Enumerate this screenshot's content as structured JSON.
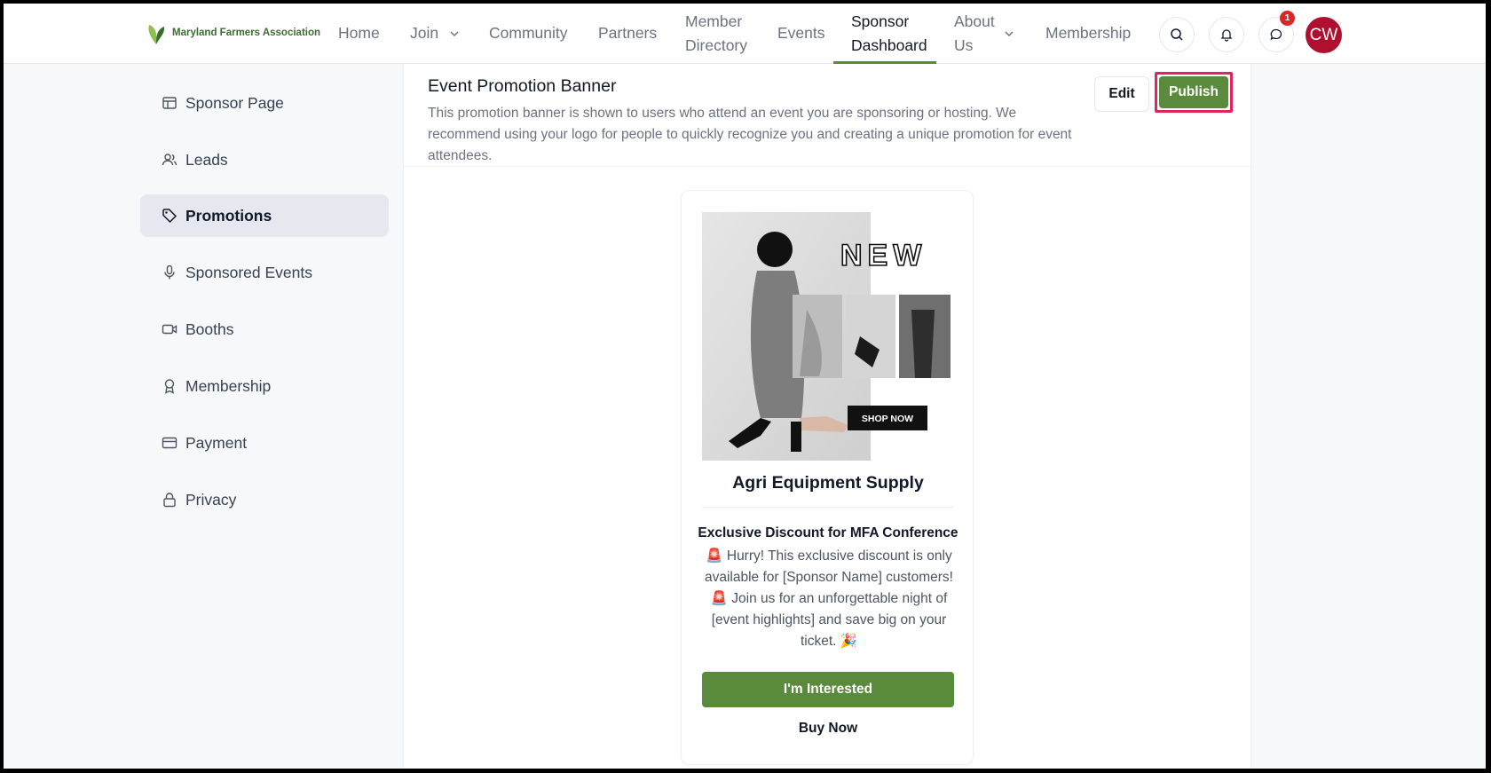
{
  "brand": {
    "name": "Maryland Farmers Association",
    "logo_icon": "leaf-icon"
  },
  "nav": {
    "home": "Home",
    "join": "Join",
    "community": "Community",
    "partners": "Partners",
    "member_directory_1": "Member",
    "member_directory_2": "Directory",
    "events": "Events",
    "sponsor_dashboard_1": "Sponsor",
    "sponsor_dashboard_2": "Dashboard",
    "about_1": "About",
    "about_2": "Us",
    "membership": "Membership"
  },
  "header_actions": {
    "notification_count": "1",
    "avatar_initials": "CW"
  },
  "sidebar": {
    "items": [
      {
        "label": "Sponsor Page",
        "icon": "layout-icon"
      },
      {
        "label": "Leads",
        "icon": "users-icon"
      },
      {
        "label": "Promotions",
        "icon": "tag-icon"
      },
      {
        "label": "Sponsored Events",
        "icon": "microphone-icon"
      },
      {
        "label": "Booths",
        "icon": "video-camera-icon"
      },
      {
        "label": "Membership",
        "icon": "award-icon"
      },
      {
        "label": "Payment",
        "icon": "credit-card-icon"
      },
      {
        "label": "Privacy",
        "icon": "lock-icon"
      }
    ],
    "active_index": 2
  },
  "panel": {
    "title": "Event Promotion Banner",
    "description": "This promotion banner is shown to users who attend an event you are sponsoring or hosting. We recommend using your logo for people to quickly recognize you and creating a unique promotion for event attendees.",
    "edit_label": "Edit",
    "publish_label": "Publish"
  },
  "promo_card": {
    "image_text_new": "NEW",
    "image_text_shop": "SHOP NOW",
    "company": "Agri Equipment Supply",
    "title": "Exclusive Discount for MFA Conference",
    "body": "🚨 Hurry! This exclusive discount is only available for [Sponsor Name] customers! 🚨 Join us for an unforgettable night of [event highlights] and save big on your ticket. 🎉",
    "primary_button": "I'm Interested",
    "secondary_button": "Buy Now"
  },
  "colors": {
    "accent": "#5a8a3c",
    "highlight": "#e0245e",
    "avatar": "#b0102f"
  }
}
